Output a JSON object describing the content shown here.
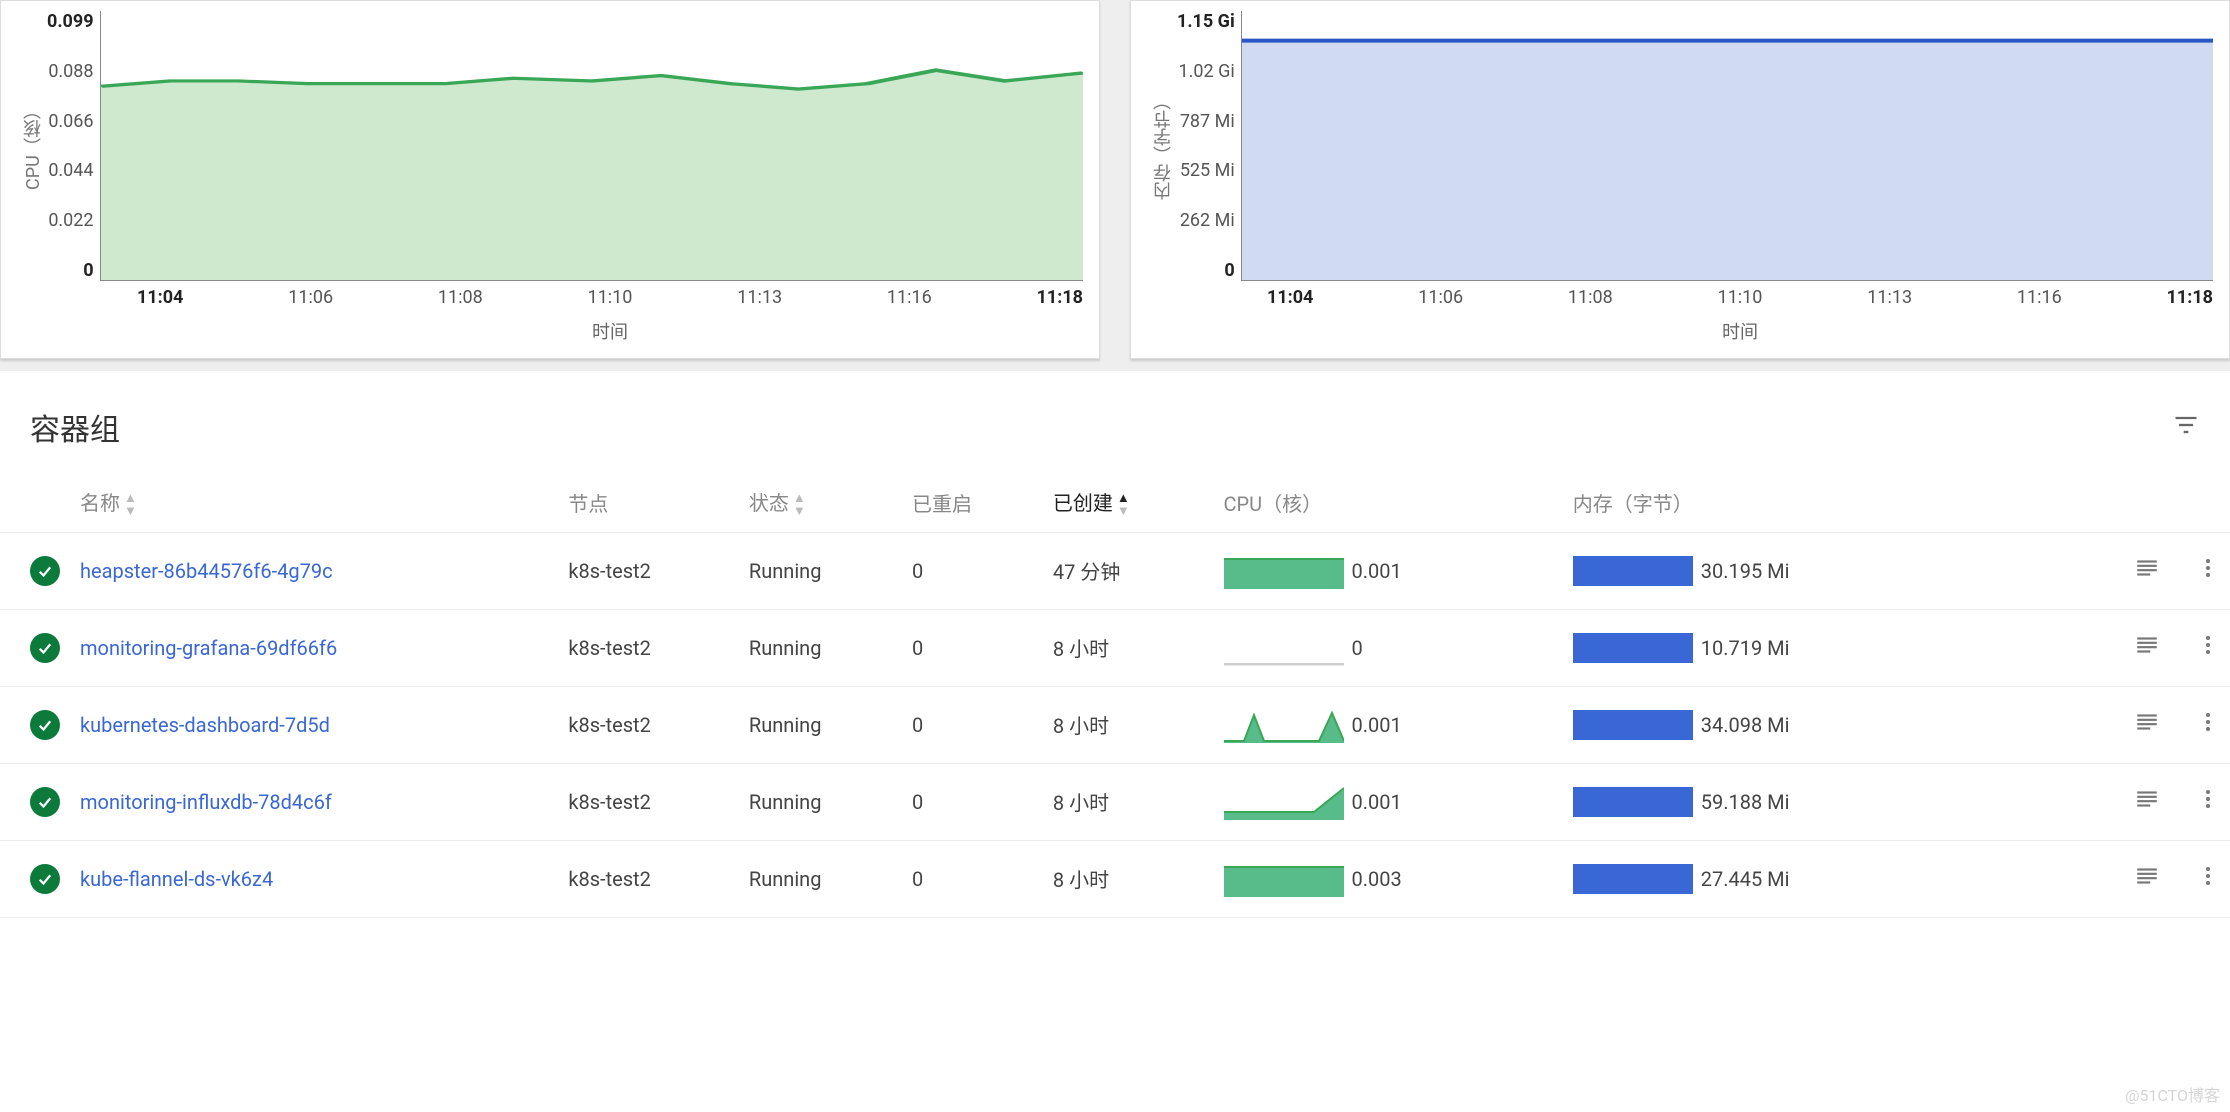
{
  "chart_data": [
    {
      "type": "area",
      "title": "",
      "ylabel": "CPU（核）",
      "xlabel": "时间",
      "ylim": [
        0,
        0.099
      ],
      "yticks": [
        "0.099",
        "0.088",
        "0.066",
        "0.044",
        "0.022",
        "0"
      ],
      "xticks": [
        "11:04",
        "11:06",
        "11:08",
        "11:10",
        "11:13",
        "11:16",
        "11:18"
      ],
      "x": [
        "11:04",
        "11:05",
        "11:06",
        "11:07",
        "11:08",
        "11:09",
        "11:10",
        "11:11",
        "11:12",
        "11:13",
        "11:14",
        "11:15",
        "11:16",
        "11:17",
        "11:18"
      ],
      "values": [
        0.071,
        0.073,
        0.073,
        0.072,
        0.072,
        0.072,
        0.074,
        0.073,
        0.075,
        0.072,
        0.07,
        0.072,
        0.077,
        0.073,
        0.076
      ],
      "stroke": "#3aa757",
      "fill": "#cfe9cf"
    },
    {
      "type": "area",
      "title": "",
      "ylabel": "内存（字节）",
      "xlabel": "时间",
      "ylim": [
        0,
        1180
      ],
      "yticks": [
        "1.15 Gi",
        "1.02 Gi",
        "787 Mi",
        "525 Mi",
        "262 Mi",
        "0"
      ],
      "xticks": [
        "11:04",
        "11:06",
        "11:08",
        "11:10",
        "11:13",
        "11:16",
        "11:18"
      ],
      "x": [
        "11:04",
        "11:05",
        "11:06",
        "11:07",
        "11:08",
        "11:09",
        "11:10",
        "11:11",
        "11:12",
        "11:13",
        "11:14",
        "11:15",
        "11:16",
        "11:17",
        "11:18"
      ],
      "values": [
        1044,
        1044,
        1044,
        1044,
        1044,
        1044,
        1044,
        1044,
        1044,
        1044,
        1044,
        1044,
        1044,
        1044,
        1044
      ],
      "stroke": "#2a56c6",
      "fill": "#d0dbf2"
    }
  ],
  "section": {
    "title": "容器组"
  },
  "columns": {
    "name": "名称",
    "node": "节点",
    "status": "状态",
    "restarts": "已重启",
    "created": "已创建",
    "cpu": "CPU（核）",
    "memory": "内存（字节）"
  },
  "rows": [
    {
      "name": "heapster-86b44576f6-4g79c",
      "node": "k8s-test2",
      "status": "Running",
      "restarts": "0",
      "created": "47 分钟",
      "cpu": "0.001",
      "cpu_spark": "flat-green",
      "memory": "30.195 Mi",
      "mem_fill": 1.0
    },
    {
      "name": "monitoring-grafana-69df66f6",
      "node": "k8s-test2",
      "status": "Running",
      "restarts": "0",
      "created": "8 小时",
      "cpu": "0",
      "cpu_spark": "flat-grey",
      "memory": "10.719 Mi",
      "mem_fill": 1.0
    },
    {
      "name": "kubernetes-dashboard-7d5d",
      "node": "k8s-test2",
      "status": "Running",
      "restarts": "0",
      "created": "8 小时",
      "cpu": "0.001",
      "cpu_spark": "spikes",
      "memory": "34.098 Mi",
      "mem_fill": 1.0
    },
    {
      "name": "monitoring-influxdb-78d4c6f",
      "node": "k8s-test2",
      "status": "Running",
      "restarts": "0",
      "created": "8 小时",
      "cpu": "0.001",
      "cpu_spark": "ramp",
      "memory": "59.188 Mi",
      "mem_fill": 1.0
    },
    {
      "name": "kube-flannel-ds-vk6z4",
      "node": "k8s-test2",
      "status": "Running",
      "restarts": "0",
      "created": "8 小时",
      "cpu": "0.003",
      "cpu_spark": "flat-green",
      "memory": "27.445 Mi",
      "mem_fill": 1.0
    }
  ],
  "watermark": "@51CTO博客"
}
